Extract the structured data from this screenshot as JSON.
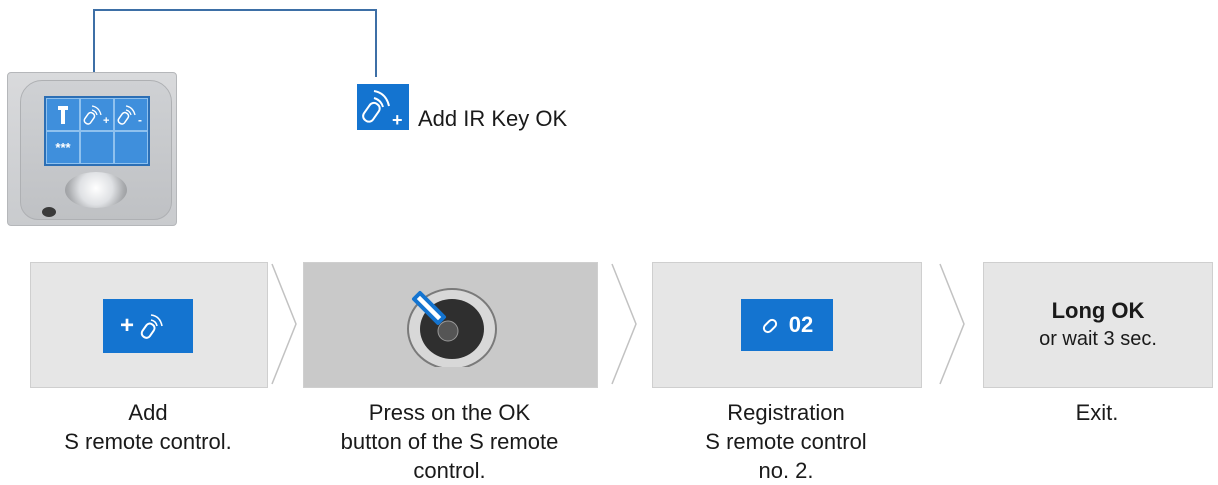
{
  "device": {
    "screen_cells": [
      "",
      "",
      "",
      "***",
      "",
      ""
    ]
  },
  "header": {
    "label": "Add IR Key OK"
  },
  "steps": [
    {
      "screen_text": "",
      "caption_lines": [
        "Add",
        "S remote control."
      ]
    },
    {
      "screen_text": "",
      "caption_lines": [
        "Press on the OK",
        "button of the S remote",
        "control."
      ]
    },
    {
      "screen_text": "02",
      "caption_lines": [
        "Registration",
        "S remote control",
        "no. 2."
      ]
    },
    {
      "screen_title": "Long OK",
      "screen_sub": "or wait 3 sec.",
      "caption_lines": [
        "Exit."
      ]
    }
  ],
  "colors": {
    "accent_blue": "#1474d0",
    "panel_gray": "#e6e6e6",
    "line_blue": "#3d6fa6"
  },
  "icons": [
    "wrench-icon",
    "remote-add-icon",
    "remote-remove-icon",
    "remote-icon",
    "remote-control-photo",
    "step-arrow"
  ]
}
